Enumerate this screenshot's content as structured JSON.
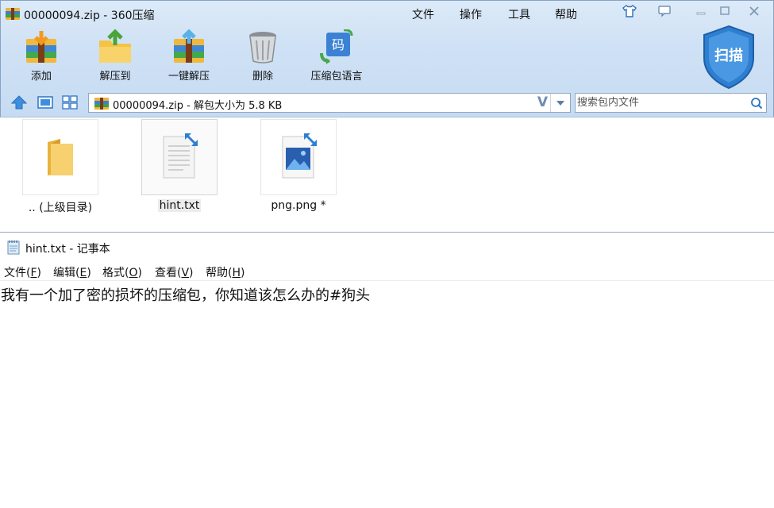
{
  "zip_window": {
    "title": "00000094.zip - 360压缩",
    "menu": [
      "文件",
      "操作",
      "工具",
      "帮助"
    ],
    "toolbar": {
      "add": "添加",
      "extract_to": "解压到",
      "one_click_extract": "一键解压",
      "delete": "删除",
      "archive_language": "压缩包语言"
    },
    "scan_label": "扫描",
    "address": "00000094.zip - 解包大小为 5.8 KB",
    "address_suffix": "V",
    "search_placeholder": "搜索包内文件",
    "files": [
      {
        "name": ".. (上级目录)",
        "type": "folder-up",
        "selected": false
      },
      {
        "name": "hint.txt",
        "type": "text",
        "selected": true
      },
      {
        "name": "png.png *",
        "type": "image",
        "selected": false
      }
    ],
    "accent_color": "#2f7fd0"
  },
  "notepad": {
    "title": "hint.txt - 记事本",
    "menu": [
      {
        "label": "文件",
        "key": "F"
      },
      {
        "label": "编辑",
        "key": "E"
      },
      {
        "label": "格式",
        "key": "O"
      },
      {
        "label": "查看",
        "key": "V"
      },
      {
        "label": "帮助",
        "key": "H"
      }
    ],
    "content": "我有一个加了密的损坏的压缩包，你知道该怎么办的#狗头"
  }
}
